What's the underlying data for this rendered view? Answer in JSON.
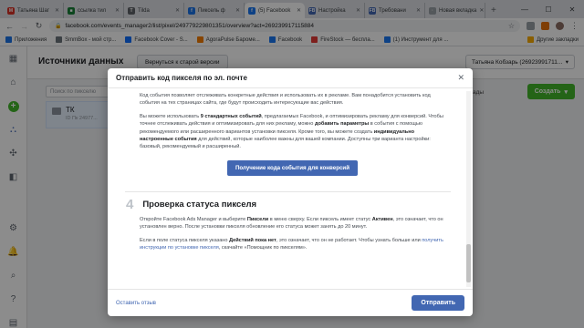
{
  "browser": {
    "tabs": [
      {
        "label": "Татьяна Шаг",
        "fav": "#d93025",
        "glyph": "M"
      },
      {
        "label": "ссылка тил",
        "fav": "#188038",
        "glyph": "■"
      },
      {
        "label": "Tilda",
        "fav": "#5f6368",
        "glyph": "T"
      },
      {
        "label": "Пиксель ф",
        "fav": "#1a73e8",
        "glyph": "f"
      },
      {
        "label": "(5) Facebook",
        "fav": "#1877f2",
        "glyph": "f",
        "active": true
      },
      {
        "label": "Настройка",
        "fav": "#4267b2",
        "glyph": "FB"
      },
      {
        "label": "Требовани",
        "fav": "#4267b2",
        "glyph": "FB"
      },
      {
        "label": "Новая вкладка",
        "fav": "#9aa0a6",
        "glyph": "·"
      }
    ],
    "url": "facebook.com/events_manager2/list/pixel/249779229801351/overview?act=269239917115884",
    "bookmarks": [
      {
        "label": "Приложения",
        "color": "#1a73e8"
      },
      {
        "label": "SmmBox - мой стр...",
        "color": "#6c757d"
      },
      {
        "label": "Facebook Cover - S...",
        "color": "#0d6efd"
      },
      {
        "label": "AgoraPulse Бароме...",
        "color": "#f57c00"
      },
      {
        "label": "Facebook",
        "color": "#1877f2"
      },
      {
        "label": "FireStock — беспла...",
        "color": "#e53935"
      },
      {
        "label": "(1) Инструмент для ...",
        "color": "#1877f2"
      }
    ],
    "bookmarks_other": "Другие закладки"
  },
  "page": {
    "title": "Источники данных",
    "old_version_button": "Вернуться к старой версии",
    "account": "Татьяна Кобзарь (26923991711...",
    "search_placeholder": "Поиск по пикселю",
    "pixel_item": {
      "name": "ТК",
      "id": "ID Пк 24977..."
    },
    "datasets_label": "ады",
    "create_button": "Создать"
  },
  "modal": {
    "title": "Отправить код пикселя по эл. почте",
    "paragraphs": [
      "Код события позволяет отслеживать конкретные действия и использовать их в рекламе. Вам понадобится установить код события на тех страницах сайта, где будут происходить интересующие вас действия.",
      [
        "Вы можете использовать ",
        {
          "b": "9 стандартных событий"
        },
        ", предлагаемых Facebook, и оптимизировать рекламу для конверсий. Чтобы точнее отслеживать действия и оптимизировать для них рекламу, можно ",
        {
          "b": "добавить параметры"
        },
        " в события с помощью рекомендуемого или расширенного вариантов установки пикселя. Кроме того, вы можете создать ",
        {
          "b": "индивидуально настроенные события"
        },
        " для действий, которые наиболее важны для вашей компании. Доступны три варианта настройки: базовый, рекомендуемый и расширенный."
      ]
    ],
    "cta_button": "Получение кода события для конверсий",
    "step_number": "4",
    "step_title": "Проверка статуса пикселя",
    "step_paragraphs": [
      [
        "Откройте Facebook Ads Manager и выберите ",
        {
          "b": "Пиксели"
        },
        " в меню сверху. Если пиксель имеет статус ",
        {
          "b": "Активен"
        },
        ", это означает, что он установлен верно. После установки пикселя обновление его статуса может занять до 20 минут."
      ],
      [
        "Если в поле статуса пикселя указано ",
        {
          "b": "Действий пока нет"
        },
        ", это означает, что он не работает. Чтобы узнать больше или ",
        {
          "l": "получить инструкции по установке пикселя"
        },
        ", скачайте «Помощник по пикселям»."
      ]
    ],
    "feedback_link": "Оставить отзыв",
    "send_button": "Отправить"
  }
}
